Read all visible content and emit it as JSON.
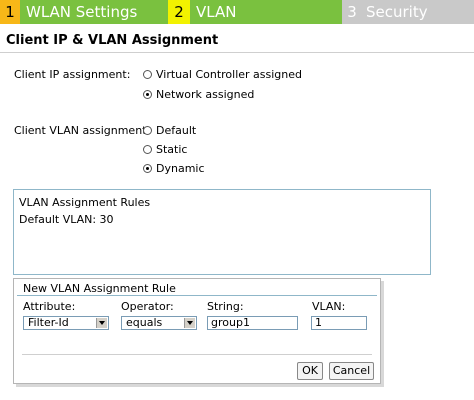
{
  "wizard": {
    "steps": [
      {
        "num": "1",
        "label": "WLAN Settings"
      },
      {
        "num": "2",
        "label": "VLAN"
      },
      {
        "num": "3",
        "label": "Security"
      }
    ]
  },
  "section_title": "Client IP & VLAN Assignment",
  "client_ip": {
    "label": "Client IP assignment:",
    "options": [
      {
        "label": "Virtual Controller assigned",
        "checked": false
      },
      {
        "label": "Network assigned",
        "checked": true
      }
    ]
  },
  "client_vlan": {
    "label": "Client VLAN assignment:",
    "options": [
      {
        "label": "Default",
        "checked": false
      },
      {
        "label": "Static",
        "checked": false
      },
      {
        "label": "Dynamic",
        "checked": true
      }
    ]
  },
  "rules": {
    "title": "VLAN Assignment Rules",
    "default_vlan": "Default VLAN: 30"
  },
  "new_rule": {
    "title": "New VLAN Assignment Rule",
    "attribute_label": "Attribute:",
    "attribute_value": "Filter-Id",
    "operator_label": "Operator:",
    "operator_value": "equals",
    "string_label": "String:",
    "string_value": "group1",
    "vlan_label": "VLAN:",
    "vlan_value": "1",
    "ok_label": "OK",
    "cancel_label": "Cancel"
  }
}
